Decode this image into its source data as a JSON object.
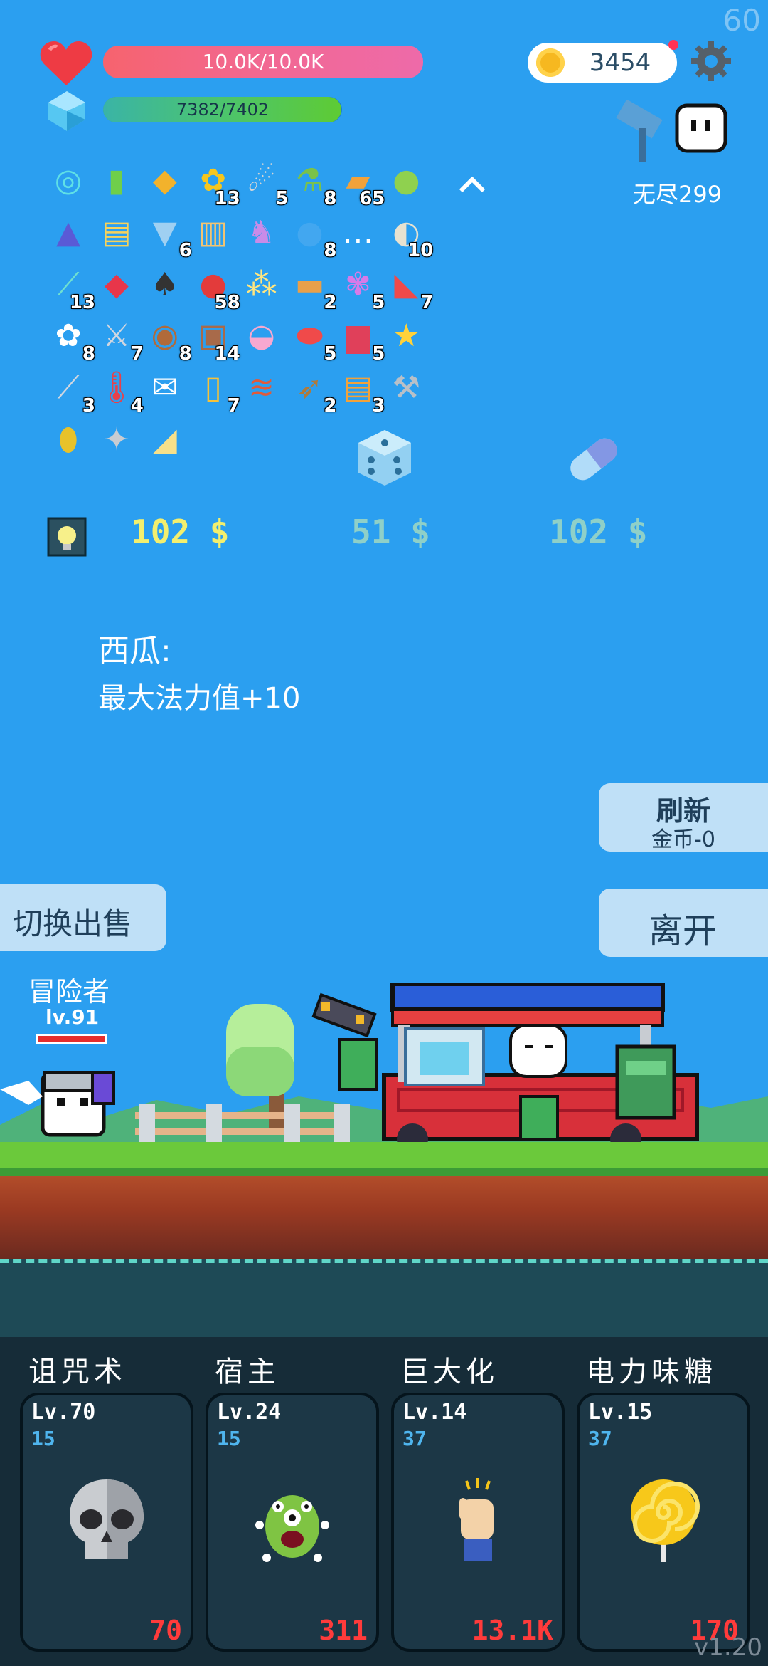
{
  "status": {
    "fps": "60",
    "version": "v1.20",
    "hp_text": "10.0K/10.0K",
    "mana_text": "7382/7402",
    "mana_fill": 0.997,
    "coins": "3454",
    "mode_label": "无尽299"
  },
  "items": [
    {
      "icon": "target-rune-icon",
      "glyph": "◎",
      "color": "#5fe0e6",
      "count": ""
    },
    {
      "icon": "green-book-icon",
      "glyph": "▮",
      "color": "#6fcf4a",
      "count": ""
    },
    {
      "icon": "pineapple-icon",
      "glyph": "◆",
      "color": "#f2b22c",
      "count": ""
    },
    {
      "icon": "sunflower-icon",
      "glyph": "✿",
      "color": "#f6c61e",
      "count": "13"
    },
    {
      "icon": "meteor-icon",
      "glyph": "☄",
      "color": "#d6d6d6",
      "count": "5"
    },
    {
      "icon": "green-potion-icon",
      "glyph": "⚗",
      "color": "#7ac24a",
      "count": "8"
    },
    {
      "icon": "thick-book-icon",
      "glyph": "▰",
      "color": "#f2a23a",
      "count": "65"
    },
    {
      "icon": "lime-icon",
      "glyph": "●",
      "color": "#8fd14f",
      "count": ""
    },
    {
      "icon": "wizard-hat-icon",
      "glyph": "▲",
      "color": "#5a5ad6",
      "count": ""
    },
    {
      "icon": "map-icon",
      "glyph": "▤",
      "color": "#f7d25a",
      "count": ""
    },
    {
      "icon": "robe-icon",
      "glyph": "▼",
      "color": "#9fd0f2",
      "count": "6"
    },
    {
      "icon": "scroll-icon",
      "glyph": "▥",
      "color": "#f4c471",
      "count": ""
    },
    {
      "icon": "unicorn-icon",
      "glyph": "♞",
      "color": "#c98be8",
      "count": ""
    },
    {
      "icon": "speech-bubble-icon",
      "glyph": "●",
      "color": "#42a7f0",
      "count": "8"
    },
    {
      "icon": "chat-dots-icon",
      "glyph": "…",
      "color": "#ffffff",
      "count": ""
    },
    {
      "icon": "coconut-drink-icon",
      "glyph": "◐",
      "color": "#e8e2d0",
      "count": "10"
    },
    {
      "icon": "dagger-icon",
      "glyph": "⟋",
      "color": "#6fe0d0",
      "count": "13"
    },
    {
      "icon": "ruby-icon",
      "glyph": "◆",
      "color": "#e8364a",
      "count": ""
    },
    {
      "icon": "playing-card-icon",
      "glyph": "♠",
      "color": "#333333",
      "count": ""
    },
    {
      "icon": "apple-icon",
      "glyph": "●",
      "color": "#e33b3b",
      "count": "58"
    },
    {
      "icon": "molecule-icon",
      "glyph": "⁂",
      "color": "#ffe680",
      "count": ""
    },
    {
      "icon": "briefcase-icon",
      "glyph": "▬",
      "color": "#e8a04a",
      "count": "2"
    },
    {
      "icon": "flower-pot-icon",
      "glyph": "✾",
      "color": "#d87ae8",
      "count": "5"
    },
    {
      "icon": "watermelon-slice-icon",
      "glyph": "◣",
      "color": "#f04a4a",
      "count": "7"
    },
    {
      "icon": "daisy-icon",
      "glyph": "✿",
      "color": "#ffffff",
      "count": "8"
    },
    {
      "icon": "sword-icon",
      "glyph": "⚔",
      "color": "#d0d6e0",
      "count": "7"
    },
    {
      "icon": "round-shield-icon",
      "glyph": "◉",
      "color": "#b06a3a",
      "count": "8"
    },
    {
      "icon": "arch-door-icon",
      "glyph": "▣",
      "color": "#a86a4a",
      "count": "14"
    },
    {
      "icon": "ice-cream-icon",
      "glyph": "◒",
      "color": "#f7a8d0",
      "count": ""
    },
    {
      "icon": "pill-icon",
      "glyph": "⬬",
      "color": "#f04a4a",
      "count": "5"
    },
    {
      "icon": "jam-jar-icon",
      "glyph": "▆",
      "color": "#e0405a",
      "count": "5"
    },
    {
      "icon": "id-card-icon",
      "glyph": "★",
      "color": "#ffd23a",
      "count": ""
    },
    {
      "icon": "knife-icon",
      "glyph": "⟋",
      "color": "#d0d6e0",
      "count": "3"
    },
    {
      "icon": "thermometer-icon",
      "glyph": "🌡",
      "color": "#e8404a",
      "count": "4"
    },
    {
      "icon": "envelope-icon",
      "glyph": "✉",
      "color": "#ffffff",
      "count": ""
    },
    {
      "icon": "beer-mug-icon",
      "glyph": "▯",
      "color": "#f6c23a",
      "count": "7"
    },
    {
      "icon": "bacon-icon",
      "glyph": "≋",
      "color": "#e05a3a",
      "count": ""
    },
    {
      "icon": "bow-icon",
      "glyph": "➶",
      "color": "#b07a3a",
      "count": "2"
    },
    {
      "icon": "parchment-icon",
      "glyph": "▤",
      "color": "#f2a23a",
      "count": "3"
    },
    {
      "icon": "double-axe-icon",
      "glyph": "⚒",
      "color": "#b8c0c8",
      "count": ""
    },
    {
      "icon": "golden-egg-icon",
      "glyph": "⬮",
      "color": "#e8c22a",
      "count": ""
    },
    {
      "icon": "compass-icon",
      "glyph": "✦",
      "color": "#c8ccd2",
      "count": ""
    },
    {
      "icon": "cheese-watermelon-icon",
      "glyph": "◢",
      "color": "#f7e08a",
      "count": ""
    }
  ],
  "shop": {
    "offers": [
      {
        "icon": "lightbulb-tile-icon",
        "price": "102 $",
        "color": "#f3ef6e"
      },
      {
        "icon": "dice-icon",
        "price": "51 $",
        "color": "#8fd0c8"
      },
      {
        "icon": "capsule-icon",
        "price": "102 $",
        "color": "#8fd0c8"
      }
    ],
    "selected_name": "西瓜:",
    "selected_effect": "最大法力值+10",
    "refresh_label": "刷新",
    "refresh_cost": "金币-0",
    "leave_label": "离开",
    "switch_label": "切换出售"
  },
  "hero": {
    "name": "冒险者",
    "level": "lv.91",
    "hp_fill": 1.0
  },
  "skills": [
    {
      "title": "诅咒术",
      "level": "Lv.70",
      "sub": "15",
      "cost": "70",
      "icon": "skull-icon"
    },
    {
      "title": "宿主",
      "level": "Lv.24",
      "sub": "15",
      "cost": "311",
      "icon": "green-monster-icon"
    },
    {
      "title": "巨大化",
      "level": "Lv.14",
      "sub": "37",
      "cost": "13.1K",
      "icon": "raised-fist-icon"
    },
    {
      "title": "电力味糖",
      "level": "Lv.15",
      "sub": "37",
      "cost": "170",
      "icon": "lollipop-icon"
    }
  ]
}
